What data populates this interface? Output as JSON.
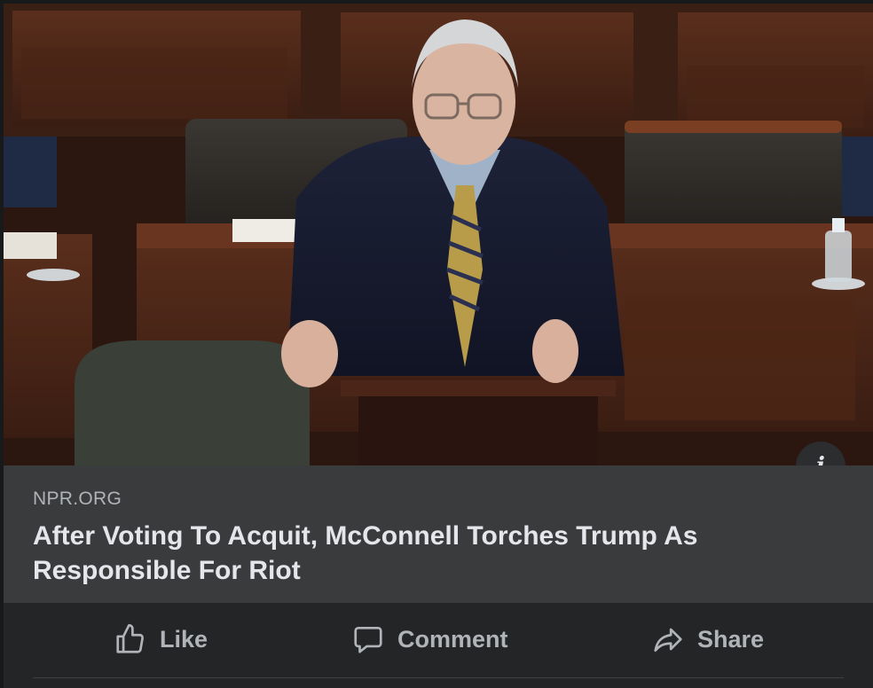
{
  "post": {
    "photo_icon": "photo-of-speaker-at-lectern",
    "info_icon": "info-icon",
    "info_glyph": "i",
    "link_domain": "NPR.ORG",
    "link_headline": "After Voting To Acquit, McConnell Torches Trump As Responsible For Riot"
  },
  "actions": {
    "like_label": "Like",
    "like_icon": "thumbs-up-icon",
    "comment_label": "Comment",
    "comment_icon": "speech-bubble-icon",
    "share_label": "Share",
    "share_icon": "share-arrow-icon"
  },
  "colors": {
    "card_background": "#242526",
    "link_preview_background": "#3a3b3c",
    "primary_text": "#e4e6eb",
    "secondary_text": "#b0b3b8"
  }
}
